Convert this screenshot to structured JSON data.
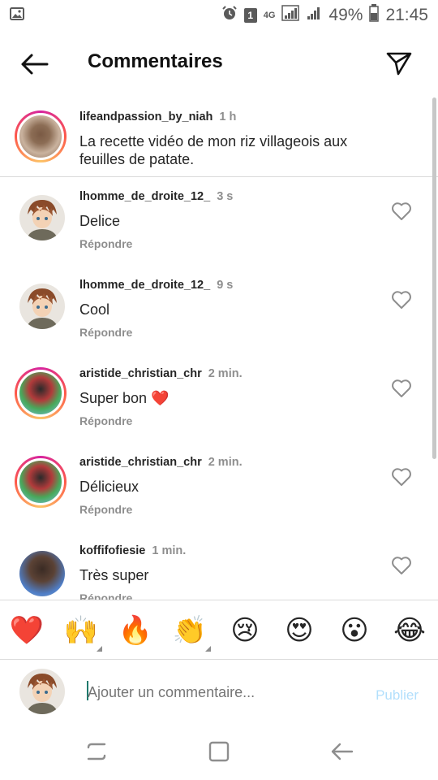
{
  "status_bar": {
    "battery": "49%",
    "time": "21:45",
    "notification_count": "1",
    "network": "4G"
  },
  "header": {
    "title": "Commentaires"
  },
  "caption": {
    "username": "lifeandpassion_by_niah",
    "time": "1 h",
    "text": "La recette vidéo de mon riz villageois aux feuilles de patate."
  },
  "comments": [
    {
      "username": "lhomme_de_droite_12_",
      "time": "3 s",
      "text": "Delice",
      "reply": "Répondre",
      "avatar": "anime-avatar"
    },
    {
      "username": "lhomme_de_droite_12_",
      "time": "9 s",
      "text": "Cool",
      "reply": "Répondre",
      "avatar": "anime-avatar"
    },
    {
      "username": "aristide_christian_chr",
      "time": "2 min.",
      "text": "Super bon ❤️",
      "reply": "Répondre",
      "avatar": "photo-avatar"
    },
    {
      "username": "aristide_christian_chr",
      "time": "2 min.",
      "text": "Délicieux",
      "reply": "Répondre",
      "avatar": "photo-avatar"
    },
    {
      "username": "koffifofiesie",
      "time": "1 min.",
      "text": "Très super",
      "reply": "Répondre",
      "avatar": "photo-avatar"
    }
  ],
  "emoji_bar": [
    "❤️",
    "🙌",
    "🔥",
    "👏",
    "😢",
    "😍",
    "😮",
    "😂"
  ],
  "composer": {
    "placeholder": "Ajouter un commentaire...",
    "publish_label": "Publier"
  },
  "colors": {
    "accent_disabled": "#b2dffc",
    "text_primary": "#262626",
    "text_secondary": "#8e8e8e",
    "heart_red": "#ed4956"
  }
}
